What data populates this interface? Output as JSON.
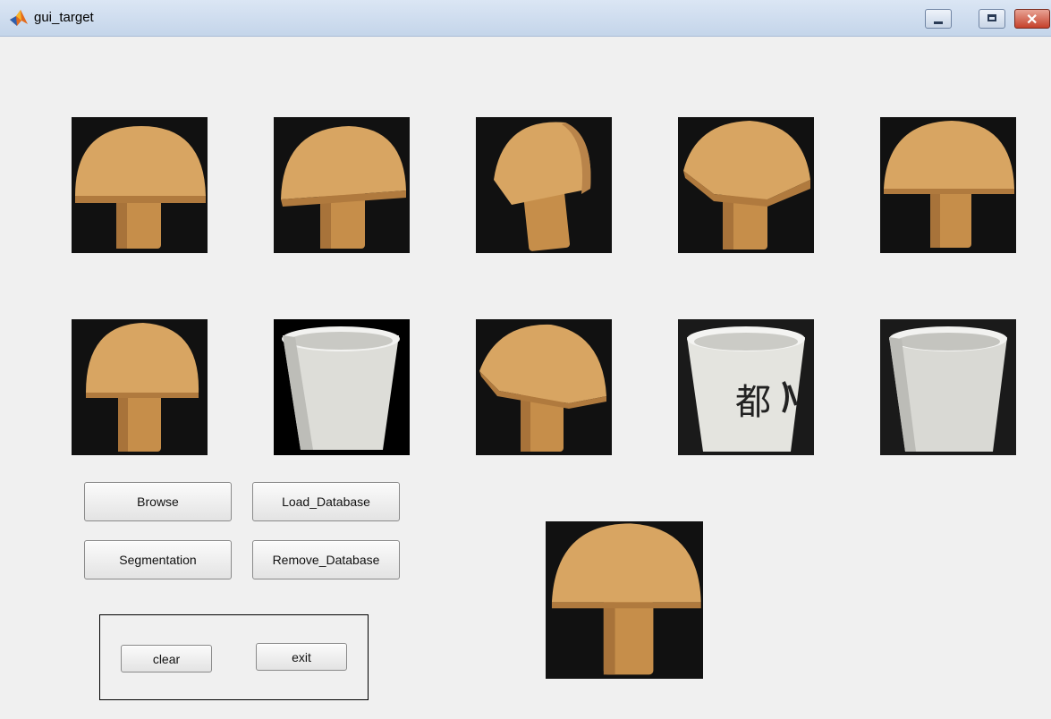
{
  "window": {
    "title": "gui_target",
    "icon": "matlab-logo-icon",
    "controls": [
      "minimize-icon",
      "maximize-icon",
      "close-icon"
    ]
  },
  "gallery": {
    "row1": [
      {
        "object": "wooden-mushroom"
      },
      {
        "object": "wooden-mushroom"
      },
      {
        "object": "wooden-mushroom"
      },
      {
        "object": "wooden-mushroom"
      },
      {
        "object": "wooden-mushroom"
      }
    ],
    "row2": [
      {
        "object": "wooden-mushroom"
      },
      {
        "object": "white-cup"
      },
      {
        "object": "wooden-mushroom"
      },
      {
        "object": "white-cup-with-calligraphy",
        "calligraphy": "都"
      },
      {
        "object": "white-cup"
      }
    ]
  },
  "buttons": {
    "browse": "Browse",
    "load_database": "Load_Database",
    "segmentation": "Segmentation",
    "remove_database": "Remove_Database",
    "clear": "clear",
    "exit": "exit"
  },
  "result": {
    "object": "wooden-mushroom"
  },
  "colors": {
    "background": "#f0f0f0",
    "titlebar": "#c4d5ea",
    "wood": "#c8954f",
    "thumb_background": "#111111"
  }
}
